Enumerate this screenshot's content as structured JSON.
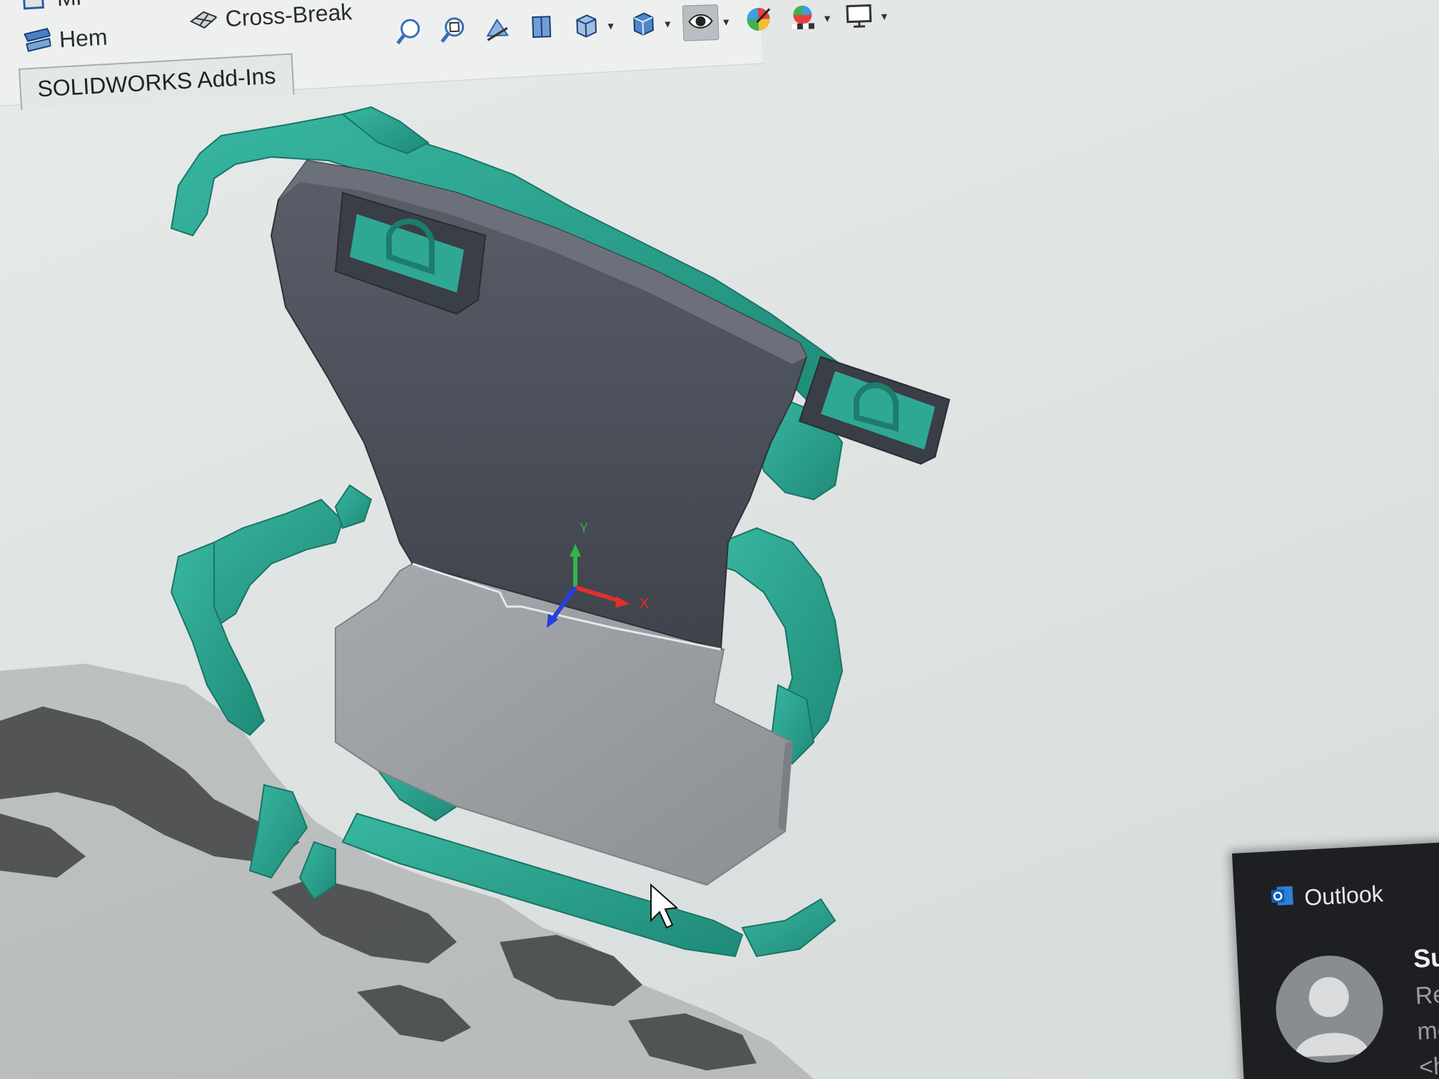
{
  "ribbon": {
    "commands": [
      {
        "label": "Mi",
        "icon": "miter-flange-icon"
      },
      {
        "label": "Hem",
        "icon": "hem-icon"
      },
      {
        "label": "Cross-Break",
        "icon": "cross-break-icon"
      }
    ],
    "active_tab": "SOLIDWORKS Add-Ins"
  },
  "heads_up_toolbar": {
    "buttons": [
      {
        "icon": "zoom-to-fit-icon"
      },
      {
        "icon": "zoom-to-area-icon"
      },
      {
        "icon": "previous-view-icon"
      },
      {
        "icon": "section-view-icon"
      },
      {
        "icon": "view-orientation-icon",
        "dropdown": true
      },
      {
        "icon": "display-style-icon",
        "dropdown": true
      },
      {
        "icon": "hide-show-items-icon",
        "dropdown": true,
        "active": true
      },
      {
        "icon": "edit-appearance-icon"
      },
      {
        "icon": "apply-scene-icon",
        "dropdown": true
      },
      {
        "icon": "view-settings-icon",
        "dropdown": true
      }
    ]
  },
  "viewport": {
    "triad": {
      "x_label": "X",
      "y_label": "Y"
    },
    "colors": {
      "scan_mesh": "#2aa38e",
      "plate_dark": "#4d515c",
      "plate_light": "#9a9ea3",
      "background": "#e2e6e5"
    }
  },
  "notification": {
    "app_name": "Outlook",
    "sender_partial": "Su",
    "line1_partial": "Re",
    "line2_partial": "mé",
    "line3_partial": "<h"
  }
}
